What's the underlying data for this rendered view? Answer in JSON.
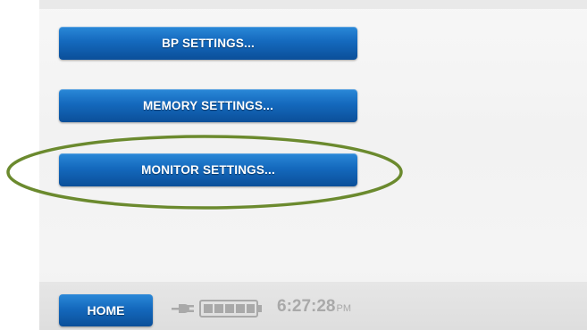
{
  "menu": {
    "bp_settings_label": "BP SETTINGS...",
    "memory_settings_label": "MEMORY SETTINGS...",
    "monitor_settings_label": "MONITOR SETTINGS..."
  },
  "footer": {
    "home_label": "HOME",
    "power_icon": "plug-icon",
    "battery_icon": "battery-icon",
    "time": "6:27:28",
    "ampm": "PM"
  },
  "colors": {
    "button_blue": "#1469bd",
    "highlight_green": "#6b8a2e",
    "clock_gray": "#a9a9a9"
  }
}
